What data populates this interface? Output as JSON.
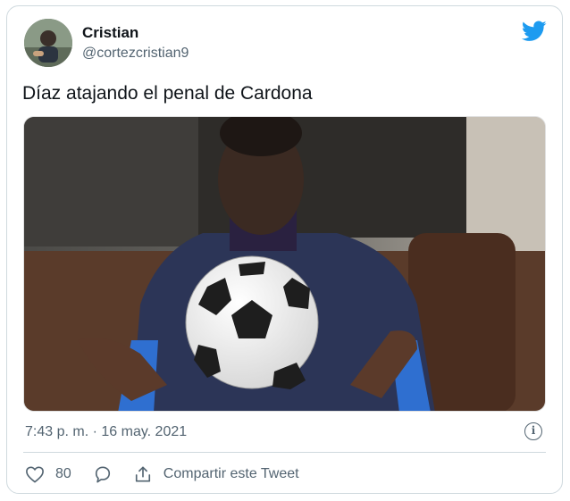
{
  "author": {
    "name": "Cristian",
    "handle": "@cortezcristian9"
  },
  "tweet": {
    "text": "Díaz atajando el penal de Cardona"
  },
  "meta": {
    "timestamp": "7:43 p. m. · 16 may. 2021",
    "info_glyph": "i"
  },
  "actions": {
    "likes": "80",
    "share_label": "Compartir este Tweet"
  },
  "icons": [
    "twitter-bird-icon",
    "info-icon",
    "heart-icon",
    "reply-icon",
    "share-icon"
  ],
  "colors": {
    "brand": "#1d9bf0",
    "text": "#0f1419",
    "secondary": "#536471",
    "border": "#cfd9de"
  }
}
